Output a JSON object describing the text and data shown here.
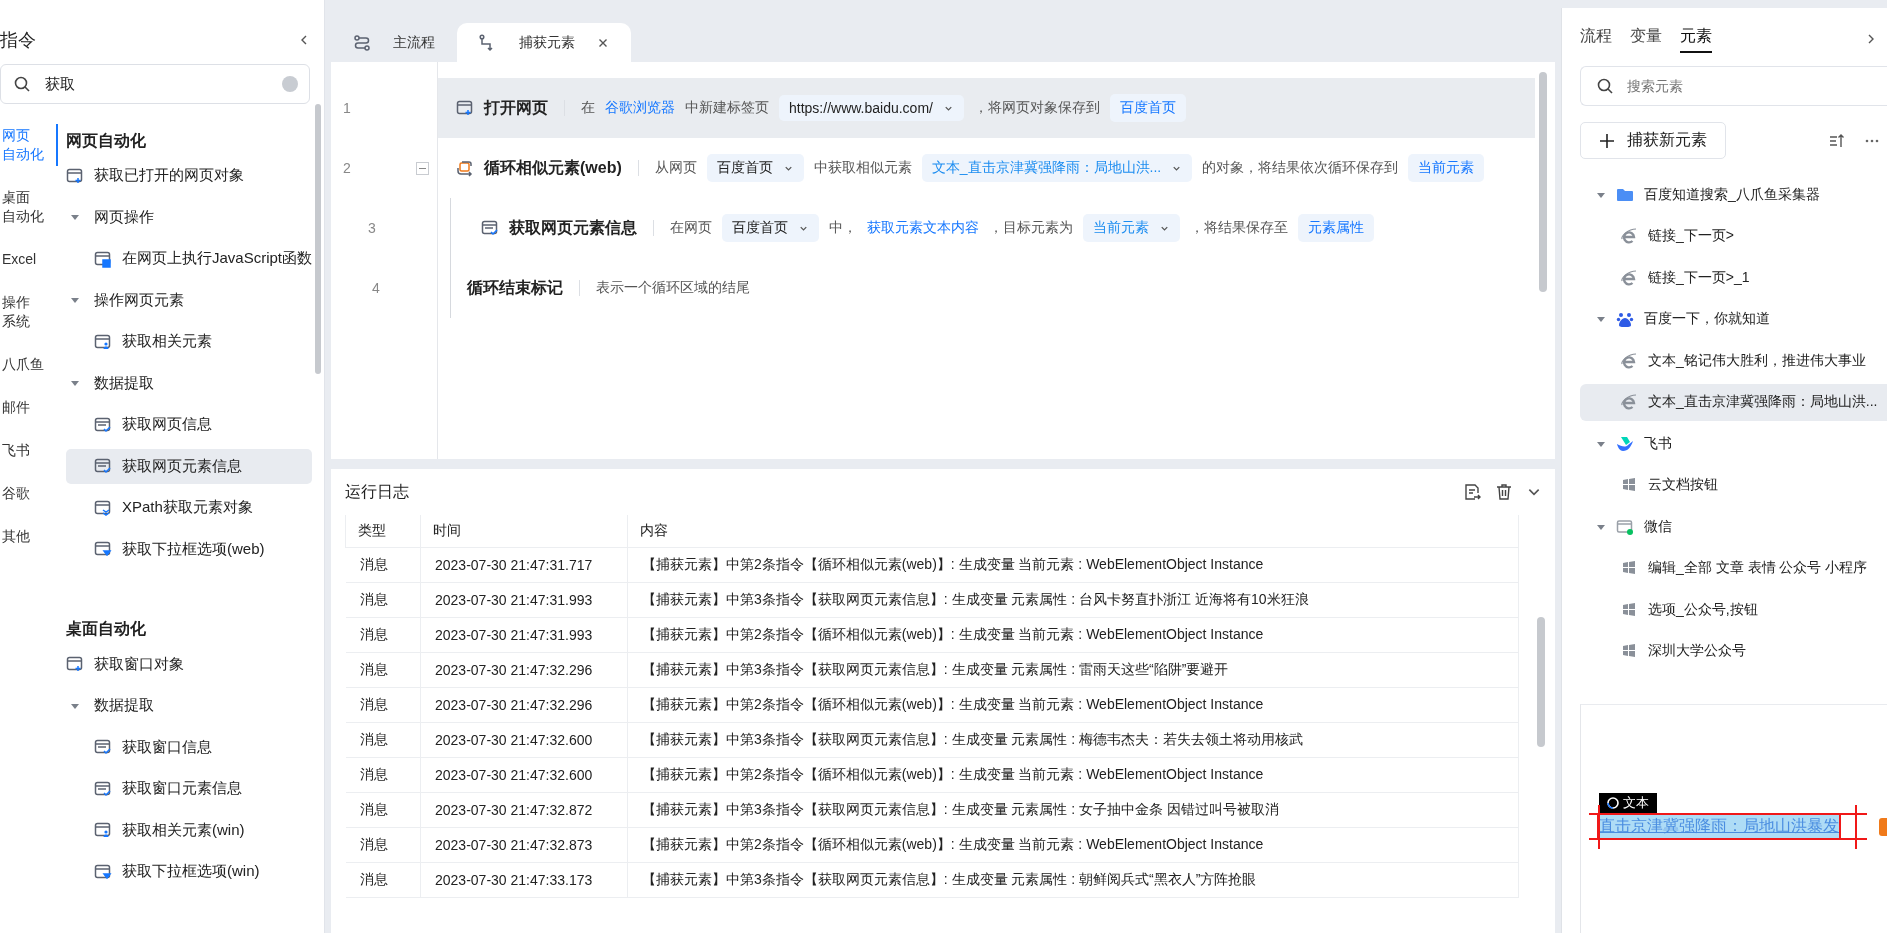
{
  "sidebar": {
    "title": "指令",
    "search": {
      "value": "获取"
    },
    "categories": [
      {
        "lines": [
          "网页",
          "自动化"
        ],
        "selected": true
      },
      {
        "lines": [
          "桌面",
          "自动化"
        ],
        "selected": false
      },
      {
        "lines": [
          "Excel"
        ],
        "selected": false
      },
      {
        "lines": [
          "操作",
          "系统"
        ],
        "selected": false
      },
      {
        "lines": [
          "八爪鱼"
        ],
        "selected": false
      },
      {
        "lines": [
          "邮件"
        ],
        "selected": false
      },
      {
        "lines": [
          "飞书"
        ],
        "selected": false
      },
      {
        "lines": [
          "谷歌"
        ],
        "selected": false
      },
      {
        "lines": [
          "其他"
        ],
        "selected": false
      }
    ],
    "sections": [
      {
        "title": "网页自动化",
        "items": [
          {
            "kind": "page",
            "label": "获取已打开的网页对象",
            "selected": false
          },
          {
            "kind": "group",
            "label": "网页操作",
            "expanded": true,
            "children": [
              {
                "kind": "js",
                "label": "在网页上执行JavaScript函数",
                "selected": false
              }
            ]
          },
          {
            "kind": "group",
            "label": "操作网页元素",
            "expanded": true,
            "children": [
              {
                "kind": "person",
                "label": "获取相关元素",
                "selected": false
              }
            ]
          },
          {
            "kind": "group",
            "label": "数据提取",
            "expanded": true,
            "children": [
              {
                "kind": "info",
                "label": "获取网页信息",
                "selected": false
              },
              {
                "kind": "info",
                "label": "获取网页元素信息",
                "selected": true
              },
              {
                "kind": "xpath",
                "label": "XPath获取元素对象",
                "selected": false
              },
              {
                "kind": "dropdown",
                "label": "获取下拉框选项(web)",
                "selected": false
              }
            ]
          }
        ]
      },
      {
        "title": "桌面自动化",
        "items": [
          {
            "kind": "window",
            "label": "获取窗口对象",
            "selected": false
          },
          {
            "kind": "group",
            "label": "数据提取",
            "expanded": true,
            "children": [
              {
                "kind": "info",
                "label": "获取窗口信息",
                "selected": false
              },
              {
                "kind": "info",
                "label": "获取窗口元素信息",
                "selected": false
              },
              {
                "kind": "person",
                "label": "获取相关元素(win)",
                "selected": false
              },
              {
                "kind": "dropdown",
                "label": "获取下拉框选项(win)",
                "selected": false
              }
            ]
          }
        ]
      }
    ]
  },
  "tabs": [
    {
      "kind": "flow",
      "label": "主流程",
      "selected": false
    },
    {
      "kind": "capture",
      "label": "捕获元素",
      "selected": true
    }
  ],
  "steps": [
    {
      "number": "1",
      "kind": "page",
      "title": "打开网页",
      "selected": true,
      "parts": [
        {
          "kind": "text",
          "text": "在"
        },
        {
          "kind": "link",
          "text": "谷歌浏览器"
        },
        {
          "kind": "text",
          "text": "中新建标签页"
        },
        {
          "kind": "select",
          "text": "https://www.baidu.com/",
          "is_variable": false
        },
        {
          "kind": "text",
          "text": "，将网页对象保存到"
        },
        {
          "kind": "var",
          "text": "百度首页"
        }
      ]
    },
    {
      "number": "2",
      "kind": "loop",
      "title": "循环相似元素(web)",
      "selected": false,
      "expanded": true,
      "parts": [
        {
          "kind": "text",
          "text": "从网页"
        },
        {
          "kind": "select",
          "text": "百度首页",
          "is_variable": false
        },
        {
          "kind": "text",
          "text": "中获取相似元素"
        },
        {
          "kind": "select",
          "text": "文本_直击京津冀强降雨：局地山洪...",
          "is_variable": true
        },
        {
          "kind": "text",
          "text": "的对象，将结果依次循环保存到"
        },
        {
          "kind": "var",
          "text": "当前元素"
        }
      ],
      "children": [
        {
          "number": "3",
          "kind": "info",
          "title": "获取网页元素信息",
          "selected": false,
          "parts": [
            {
              "kind": "text",
              "text": "在网页"
            },
            {
              "kind": "select",
              "text": "百度首页",
              "is_variable": false
            },
            {
              "kind": "text",
              "text": "中，"
            },
            {
              "kind": "link",
              "text": "获取元素文本内容"
            },
            {
              "kind": "text",
              "text": "，目标元素为"
            },
            {
              "kind": "select",
              "text": "当前元素",
              "is_variable": true
            },
            {
              "kind": "text",
              "text": "，将结果保存至"
            },
            {
              "kind": "var",
              "text": "元素属性"
            }
          ]
        }
      ]
    },
    {
      "number": "4",
      "kind": "end",
      "title": "循环结束标记",
      "selected": false,
      "parts": [
        {
          "kind": "text",
          "text": "表示一个循环区域的结尾"
        }
      ]
    }
  ],
  "log": {
    "title": "运行日志",
    "columns": [
      "类型",
      "时间",
      "内容"
    ],
    "rows": [
      [
        "消息",
        "2023-07-30 21:47:31.717",
        "【捕获元素】中第2条指令【循环相似元素(web)】: 生成变量 当前元素 : WebElementObject Instance"
      ],
      [
        "消息",
        "2023-07-30 21:47:31.993",
        "【捕获元素】中第3条指令【获取网页元素信息】: 生成变量 元素属性 : 台风卡努直扑浙江 近海将有10米狂浪"
      ],
      [
        "消息",
        "2023-07-30 21:47:31.993",
        "【捕获元素】中第2条指令【循环相似元素(web)】: 生成变量 当前元素 : WebElementObject Instance"
      ],
      [
        "消息",
        "2023-07-30 21:47:32.296",
        "【捕获元素】中第3条指令【获取网页元素信息】: 生成变量 元素属性 : 雷雨天这些“陷阱”要避开"
      ],
      [
        "消息",
        "2023-07-30 21:47:32.296",
        "【捕获元素】中第2条指令【循环相似元素(web)】: 生成变量 当前元素 : WebElementObject Instance"
      ],
      [
        "消息",
        "2023-07-30 21:47:32.600",
        "【捕获元素】中第3条指令【获取网页元素信息】: 生成变量 元素属性 : 梅德韦杰夫：若失去领土将动用核武"
      ],
      [
        "消息",
        "2023-07-30 21:47:32.600",
        "【捕获元素】中第2条指令【循环相似元素(web)】: 生成变量 当前元素 : WebElementObject Instance"
      ],
      [
        "消息",
        "2023-07-30 21:47:32.872",
        "【捕获元素】中第3条指令【获取网页元素信息】: 生成变量 元素属性 : 女子抽中金条 因错过叫号被取消"
      ],
      [
        "消息",
        "2023-07-30 21:47:32.873",
        "【捕获元素】中第2条指令【循环相似元素(web)】: 生成变量 当前元素 : WebElementObject Instance"
      ],
      [
        "消息",
        "2023-07-30 21:47:33.173",
        "【捕获元素】中第3条指令【获取网页元素信息】: 生成变量 元素属性 : 朝鲜阅兵式“黑衣人”方阵抢眼"
      ]
    ]
  },
  "panel": {
    "tabs": [
      {
        "label": "流程",
        "selected": false
      },
      {
        "label": "变量",
        "selected": false
      },
      {
        "label": "元素",
        "selected": true
      }
    ],
    "search": {
      "placeholder": "搜索元素"
    },
    "capture_button": "捕获新元素",
    "groups": [
      {
        "kind": "folder",
        "label": "百度知道搜索_八爪鱼采集器",
        "expanded": true,
        "children": [
          {
            "kind": "ie",
            "label": "链接_下一页>",
            "selected": false
          },
          {
            "kind": "ie",
            "label": "链接_下一页>_1",
            "selected": false
          }
        ]
      },
      {
        "kind": "paw",
        "label": "百度一下，你就知道",
        "expanded": true,
        "children": [
          {
            "kind": "ie",
            "label": "文本_铭记伟大胜利，推进伟大事业",
            "selected": false
          },
          {
            "kind": "ie",
            "label": "文本_直击京津冀强降雨：局地山洪...",
            "selected": true
          }
        ]
      },
      {
        "kind": "bird",
        "label": "飞书",
        "expanded": true,
        "children": [
          {
            "kind": "win",
            "label": "云文档按钮",
            "selected": false
          }
        ]
      },
      {
        "kind": "chat",
        "label": "微信",
        "expanded": true,
        "children": [
          {
            "kind": "win",
            "label": "编辑_全部 文章 表情 公众号 小程序",
            "selected": false
          },
          {
            "kind": "win",
            "label": "选项_公众号,按钮",
            "selected": false
          },
          {
            "kind": "win",
            "label": "深圳大学公众号",
            "selected": false
          }
        ]
      }
    ],
    "preview": {
      "tag": "文本",
      "text": "直击京津冀强降雨：局地山洪暴发"
    }
  }
}
